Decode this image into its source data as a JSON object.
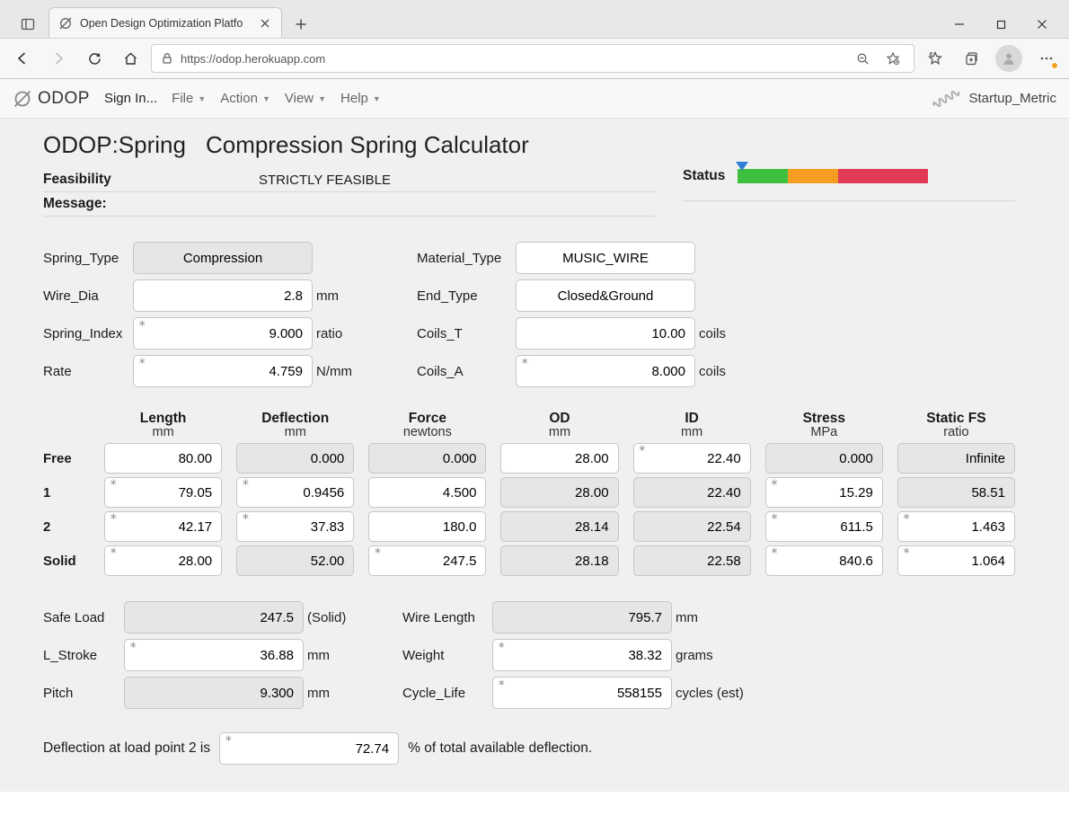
{
  "browser": {
    "tab_title": "Open Design Optimization Platfo",
    "url": "https://odop.herokuapp.com"
  },
  "appbar": {
    "brand": "ODOP",
    "signin": "Sign In...",
    "file": "File",
    "action": "Action",
    "view": "View",
    "help": "Help",
    "startup": "Startup_Metric"
  },
  "header": {
    "title1": "ODOP:Spring",
    "title2": "Compression Spring Calculator",
    "feas_label": "Feasibility",
    "feas_value": "STRICTLY FEASIBLE",
    "msg_label": "Message:",
    "status_label": "Status"
  },
  "params": {
    "spring_type_label": "Spring_Type",
    "spring_type": "Compression",
    "wire_dia_label": "Wire_Dia",
    "wire_dia": "2.8",
    "wire_dia_unit": "mm",
    "spring_index_label": "Spring_Index",
    "spring_index": "9.000",
    "spring_index_unit": "ratio",
    "rate_label": "Rate",
    "rate": "4.759",
    "rate_unit": "N/mm",
    "material_label": "Material_Type",
    "material": "MUSIC_WIRE",
    "end_label": "End_Type",
    "end": "Closed&Ground",
    "coils_t_label": "Coils_T",
    "coils_t": "10.00",
    "coils_t_unit": "coils",
    "coils_a_label": "Coils_A",
    "coils_a": "8.000",
    "coils_a_unit": "coils"
  },
  "table": {
    "heads": {
      "length": "Length",
      "deflection": "Deflection",
      "force": "Force",
      "od": "OD",
      "id": "ID",
      "stress": "Stress",
      "fs": "Static FS"
    },
    "units": {
      "length": "mm",
      "deflection": "mm",
      "force": "newtons",
      "od": "mm",
      "id": "mm",
      "stress": "MPa",
      "fs": "ratio"
    },
    "rows": {
      "free": {
        "label": "Free",
        "length": "80.00",
        "deflection": "0.000",
        "force": "0.000",
        "od": "28.00",
        "id": "22.40",
        "stress": "0.000",
        "fs": "Infinite"
      },
      "p1": {
        "label": "1",
        "length": "79.05",
        "deflection": "0.9456",
        "force": "4.500",
        "od": "28.00",
        "id": "22.40",
        "stress": "15.29",
        "fs": "58.51"
      },
      "p2": {
        "label": "2",
        "length": "42.17",
        "deflection": "37.83",
        "force": "180.0",
        "od": "28.14",
        "id": "22.54",
        "stress": "611.5",
        "fs": "1.463"
      },
      "solid": {
        "label": "Solid",
        "length": "28.00",
        "deflection": "52.00",
        "force": "247.5",
        "od": "28.18",
        "id": "22.58",
        "stress": "840.6",
        "fs": "1.064"
      }
    }
  },
  "summary": {
    "safe_load_label": "Safe Load",
    "safe_load": "247.5",
    "safe_load_unit": "(Solid)",
    "lstroke_label": "L_Stroke",
    "lstroke": "36.88",
    "lstroke_unit": "mm",
    "pitch_label": "Pitch",
    "pitch": "9.300",
    "pitch_unit": "mm",
    "wirelen_label": "Wire Length",
    "wirelen": "795.7",
    "wirelen_unit": "mm",
    "weight_label": "Weight",
    "weight": "38.32",
    "weight_unit": "grams",
    "cycle_label": "Cycle_Life",
    "cycle": "558155",
    "cycle_unit": "cycles (est)"
  },
  "deflection": {
    "pre": "Deflection at load point 2 is",
    "value": "72.74",
    "post": "% of total available deflection."
  }
}
